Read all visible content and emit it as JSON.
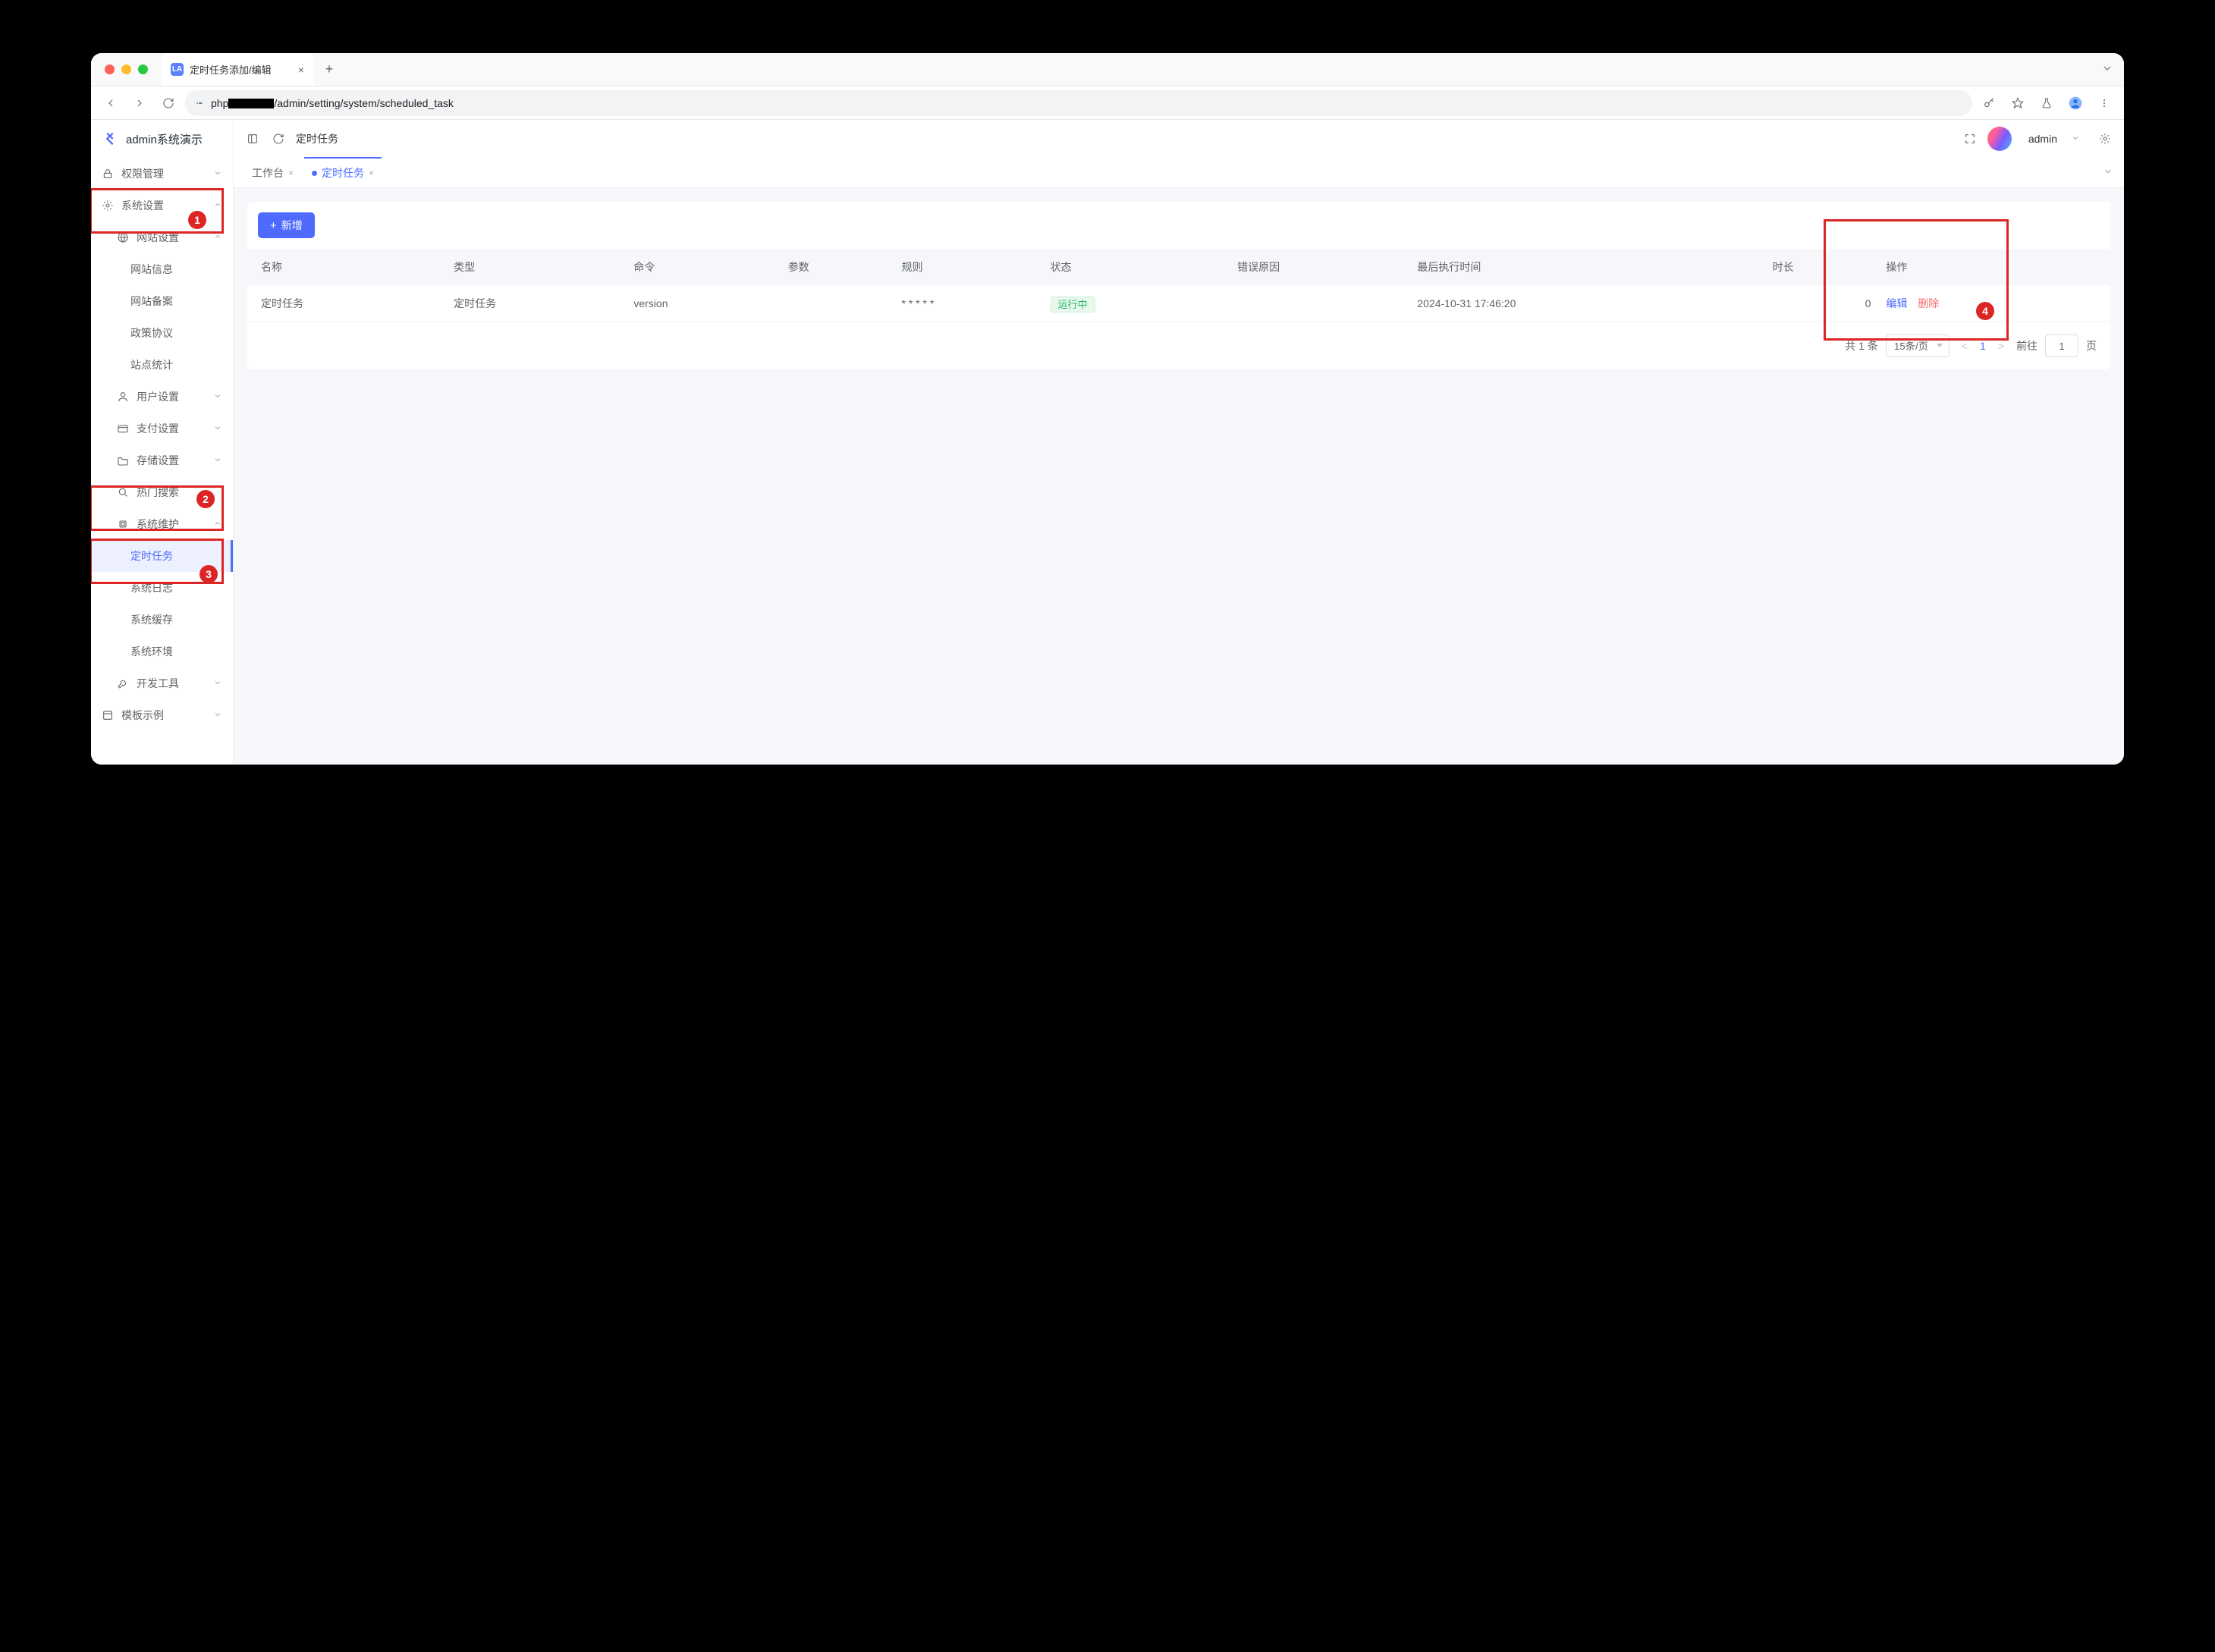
{
  "browser": {
    "tab_title": "定时任务添加/编辑",
    "favicon_text": "LA",
    "url_host": "php",
    "url_path": "/admin/setting/system/scheduled_task"
  },
  "brand": "admin系统演示",
  "topbar": {
    "breadcrumb": "定时任务",
    "user": "admin"
  },
  "tabs": [
    {
      "label": "工作台",
      "active": false
    },
    {
      "label": "定时任务",
      "active": true
    }
  ],
  "sidebar": {
    "items": [
      {
        "label": "权限管理",
        "icon": "lock",
        "chev": "down"
      },
      {
        "label": "系统设置",
        "icon": "gear",
        "chev": "up"
      },
      {
        "label": "网站设置",
        "icon": "globe",
        "chev": "up",
        "depth": 1
      },
      {
        "label": "网站信息",
        "depth": 2
      },
      {
        "label": "网站备案",
        "depth": 2
      },
      {
        "label": "政策协议",
        "depth": 2
      },
      {
        "label": "站点统计",
        "depth": 2
      },
      {
        "label": "用户设置",
        "icon": "user",
        "chev": "down",
        "depth": 1
      },
      {
        "label": "支付设置",
        "icon": "card",
        "chev": "down",
        "depth": 1
      },
      {
        "label": "存储设置",
        "icon": "folder",
        "chev": "down",
        "depth": 1
      },
      {
        "label": "热门搜索",
        "icon": "search",
        "depth": 1
      },
      {
        "label": "系统维护",
        "icon": "cpu",
        "chev": "up",
        "depth": 1
      },
      {
        "label": "定时任务",
        "depth": 2,
        "active": true
      },
      {
        "label": "系统日志",
        "depth": 2
      },
      {
        "label": "系统缓存",
        "depth": 2
      },
      {
        "label": "系统环境",
        "depth": 2
      },
      {
        "label": "开发工具",
        "icon": "wrench",
        "chev": "down",
        "depth": 1
      },
      {
        "label": "模板示例",
        "icon": "box",
        "chev": "down"
      }
    ]
  },
  "actions": {
    "add_label": "新增"
  },
  "table": {
    "columns": [
      "名称",
      "类型",
      "命令",
      "参数",
      "规则",
      "状态",
      "错误原因",
      "最后执行时间",
      "时长",
      "操作"
    ],
    "row": {
      "name": "定时任务",
      "type": "定时任务",
      "cmd": "version",
      "params": "",
      "rule": "* * * * *",
      "status": "运行中",
      "error": "",
      "last_exec": "2024-10-31 17:46:20",
      "duration": "0"
    },
    "op": {
      "edit": "编辑",
      "delete": "删除"
    }
  },
  "pagination": {
    "total_text": "共 1 条",
    "page_size": "15条/页",
    "current_page": "1",
    "jump_label": "前往",
    "jump_value": "1",
    "jump_suffix": "页"
  },
  "annotation_numbers": {
    "a1": "1",
    "a2": "2",
    "a3": "3",
    "a4": "4"
  }
}
